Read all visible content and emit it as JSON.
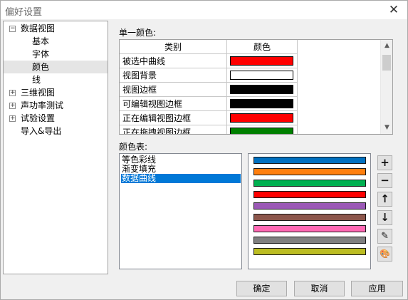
{
  "window": {
    "title": "偏好设置",
    "close_glyph": "✕"
  },
  "tree": {
    "items": [
      {
        "label": "数据视图",
        "expander": "−"
      },
      {
        "label": "基本"
      },
      {
        "label": "字体"
      },
      {
        "label": "颜色",
        "selected": true
      },
      {
        "label": "线"
      },
      {
        "label": "三维视图",
        "expander": "+"
      },
      {
        "label": "声功率测试",
        "expander": "+"
      },
      {
        "label": "试验设置",
        "expander": "+"
      },
      {
        "label": "导入&导出"
      }
    ]
  },
  "single_color": {
    "label": "单一颜色:",
    "headers": {
      "category": "类别",
      "color": "颜色"
    },
    "rows": [
      {
        "category": "被选中曲线",
        "color": "#ff0000"
      },
      {
        "category": "视图背景",
        "color": "#ffffff"
      },
      {
        "category": "视图边框",
        "color": "#000000"
      },
      {
        "category": "可编辑视图边框",
        "color": "#000000"
      },
      {
        "category": "正在编辑视图边框",
        "color": "#ff0000"
      },
      {
        "category": "正在拖拽视图边框",
        "color": "#008000"
      }
    ]
  },
  "color_table": {
    "label": "颜色表:",
    "items": [
      {
        "label": "等色彩线"
      },
      {
        "label": "渐变填充"
      },
      {
        "label": "数据曲线",
        "selected": true
      }
    ],
    "palette": [
      "#0070c0",
      "#ff7f0e",
      "#00b050",
      "#ff0000",
      "#9b59b6",
      "#8c564b",
      "#ff69b4",
      "#7f7f7f",
      "#bcbd22"
    ]
  },
  "tools": {
    "add": "+",
    "remove": "−",
    "move_up": "↑",
    "move_down": "↓",
    "edit": "✎",
    "palette": "🎨"
  },
  "buttons": {
    "ok": "确定",
    "cancel": "取消",
    "apply": "应用"
  }
}
